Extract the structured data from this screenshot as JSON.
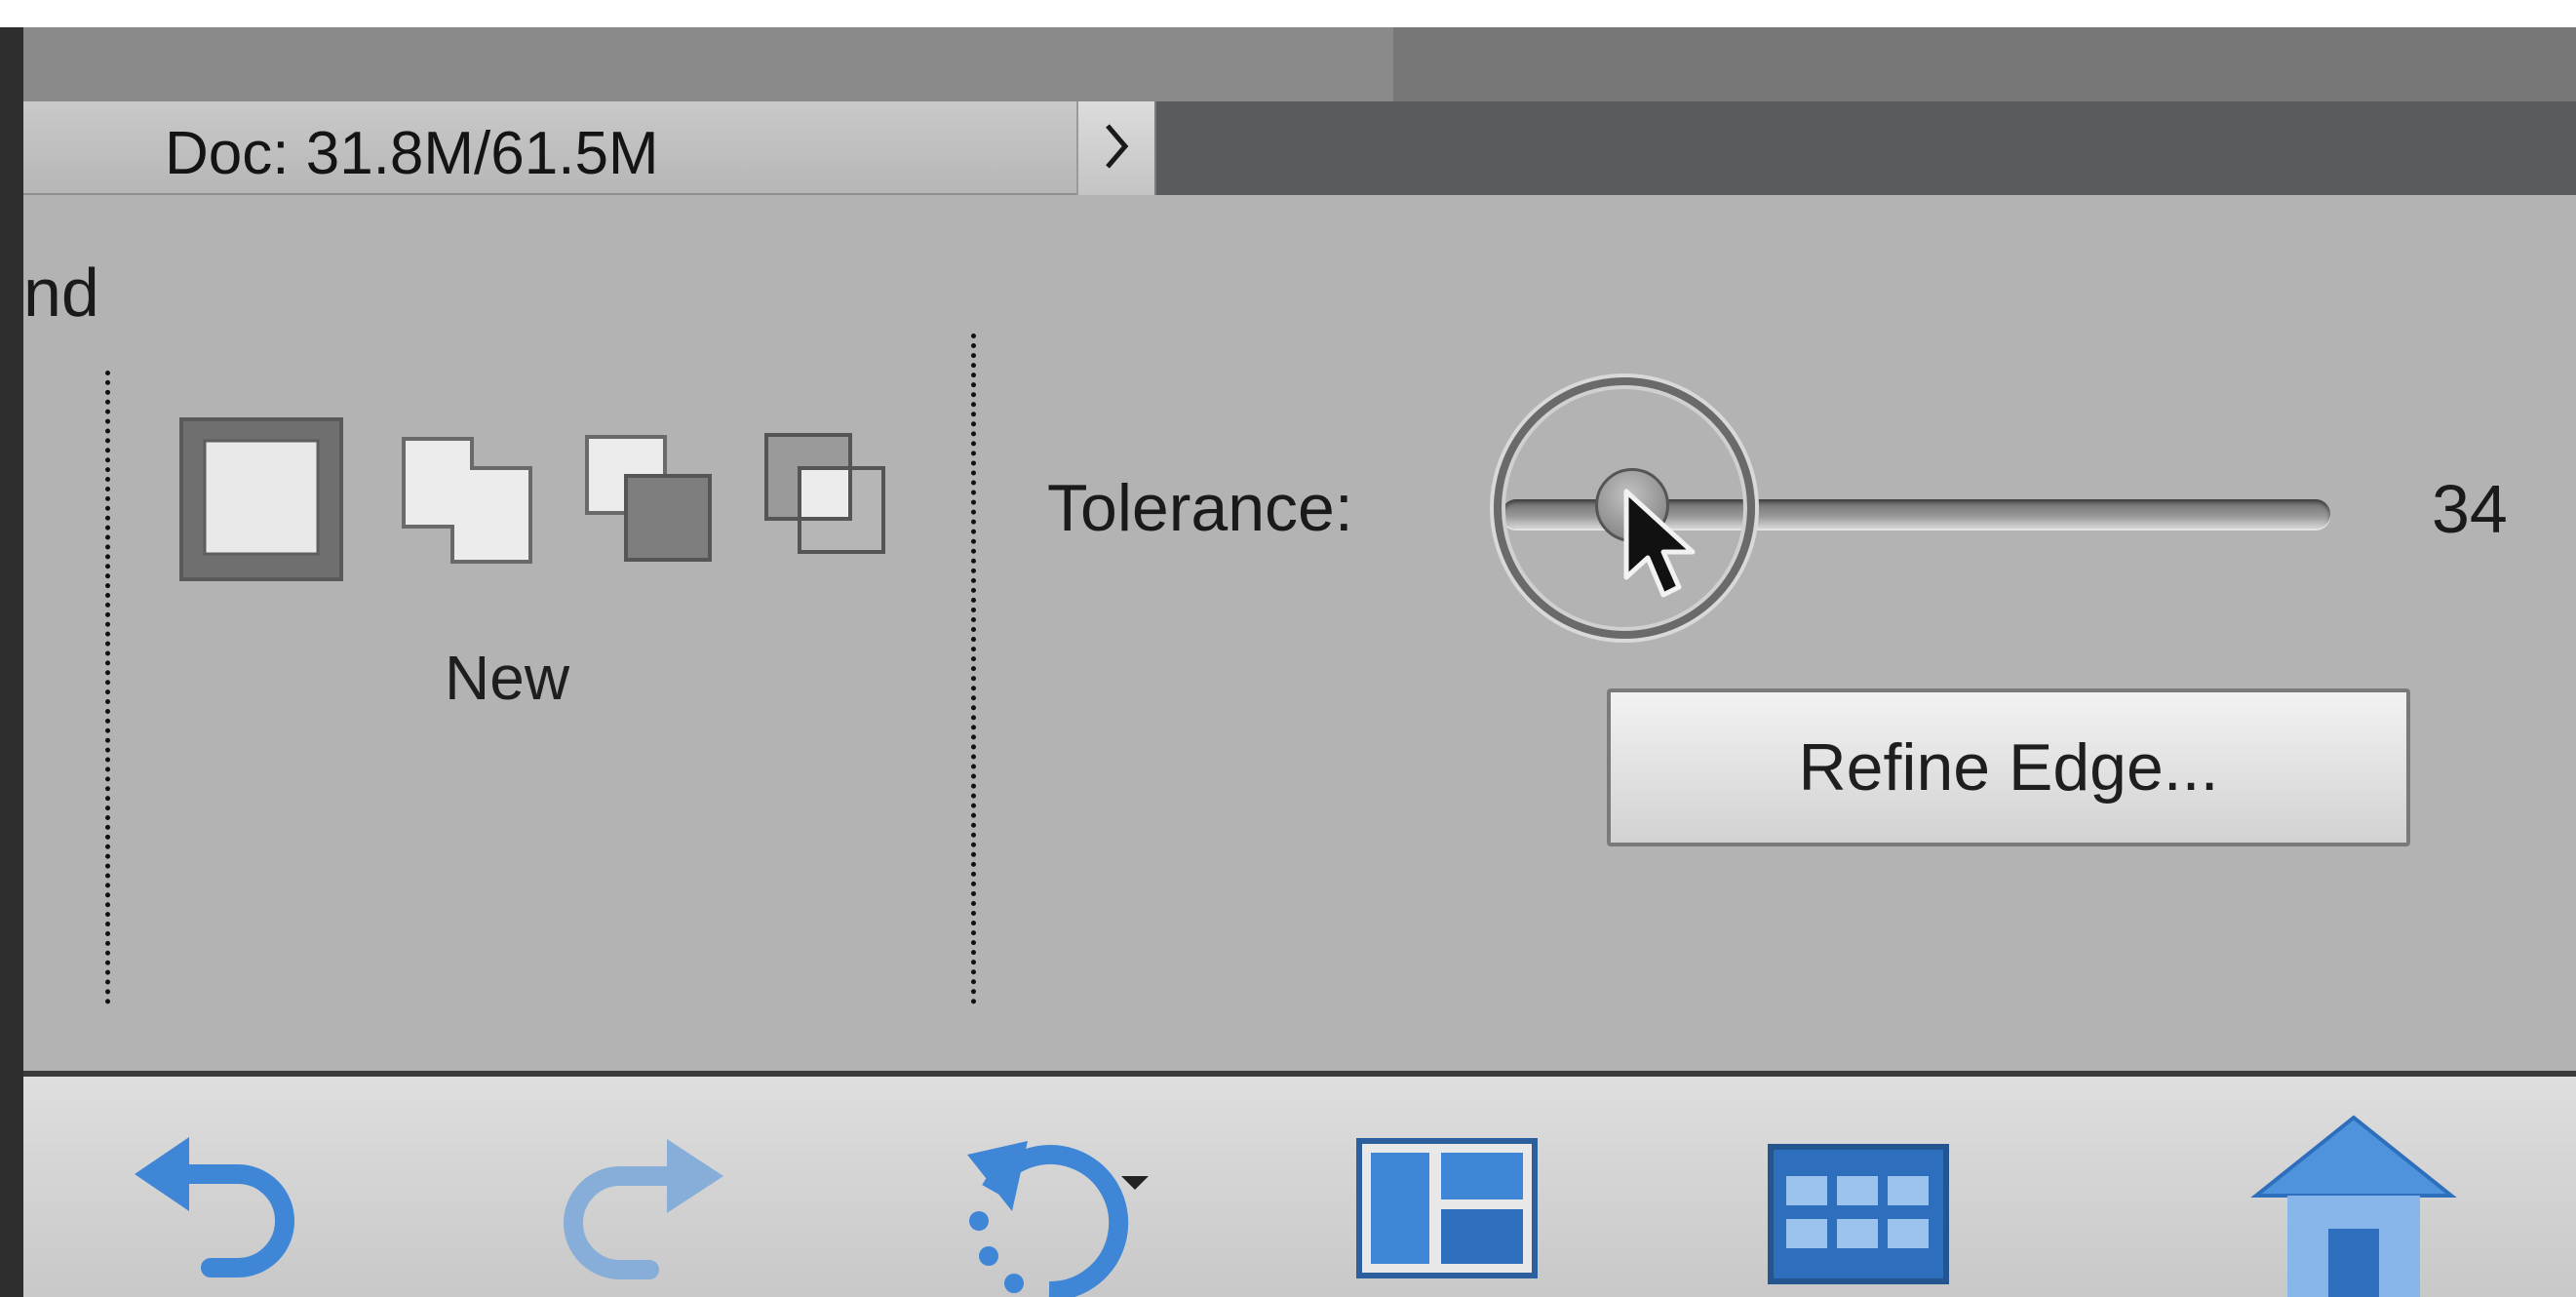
{
  "status_bar": {
    "doc_info": "Doc: 31.8M/61.5M",
    "expand_icon": "chevron-right-icon"
  },
  "options_panel": {
    "cut_off_label": "nd",
    "selection_modes": {
      "items": [
        "new-selection-icon",
        "add-to-selection-icon",
        "subtract-from-selection-icon",
        "intersect-selection-icon"
      ],
      "current_label": "New"
    },
    "tolerance": {
      "label": "Tolerance:",
      "value": "34"
    },
    "refine_edge_label": "Refine Edge..."
  },
  "bottom_toolbar": {
    "icons": [
      "undo-icon",
      "redo-icon",
      "rotate-icon",
      "layout-icon",
      "organizer-icon",
      "home-icon"
    ]
  },
  "colors": {
    "panel": "#b3b3b3",
    "status_bar": "#595c5f",
    "accent_blue": "#3f86d6"
  }
}
